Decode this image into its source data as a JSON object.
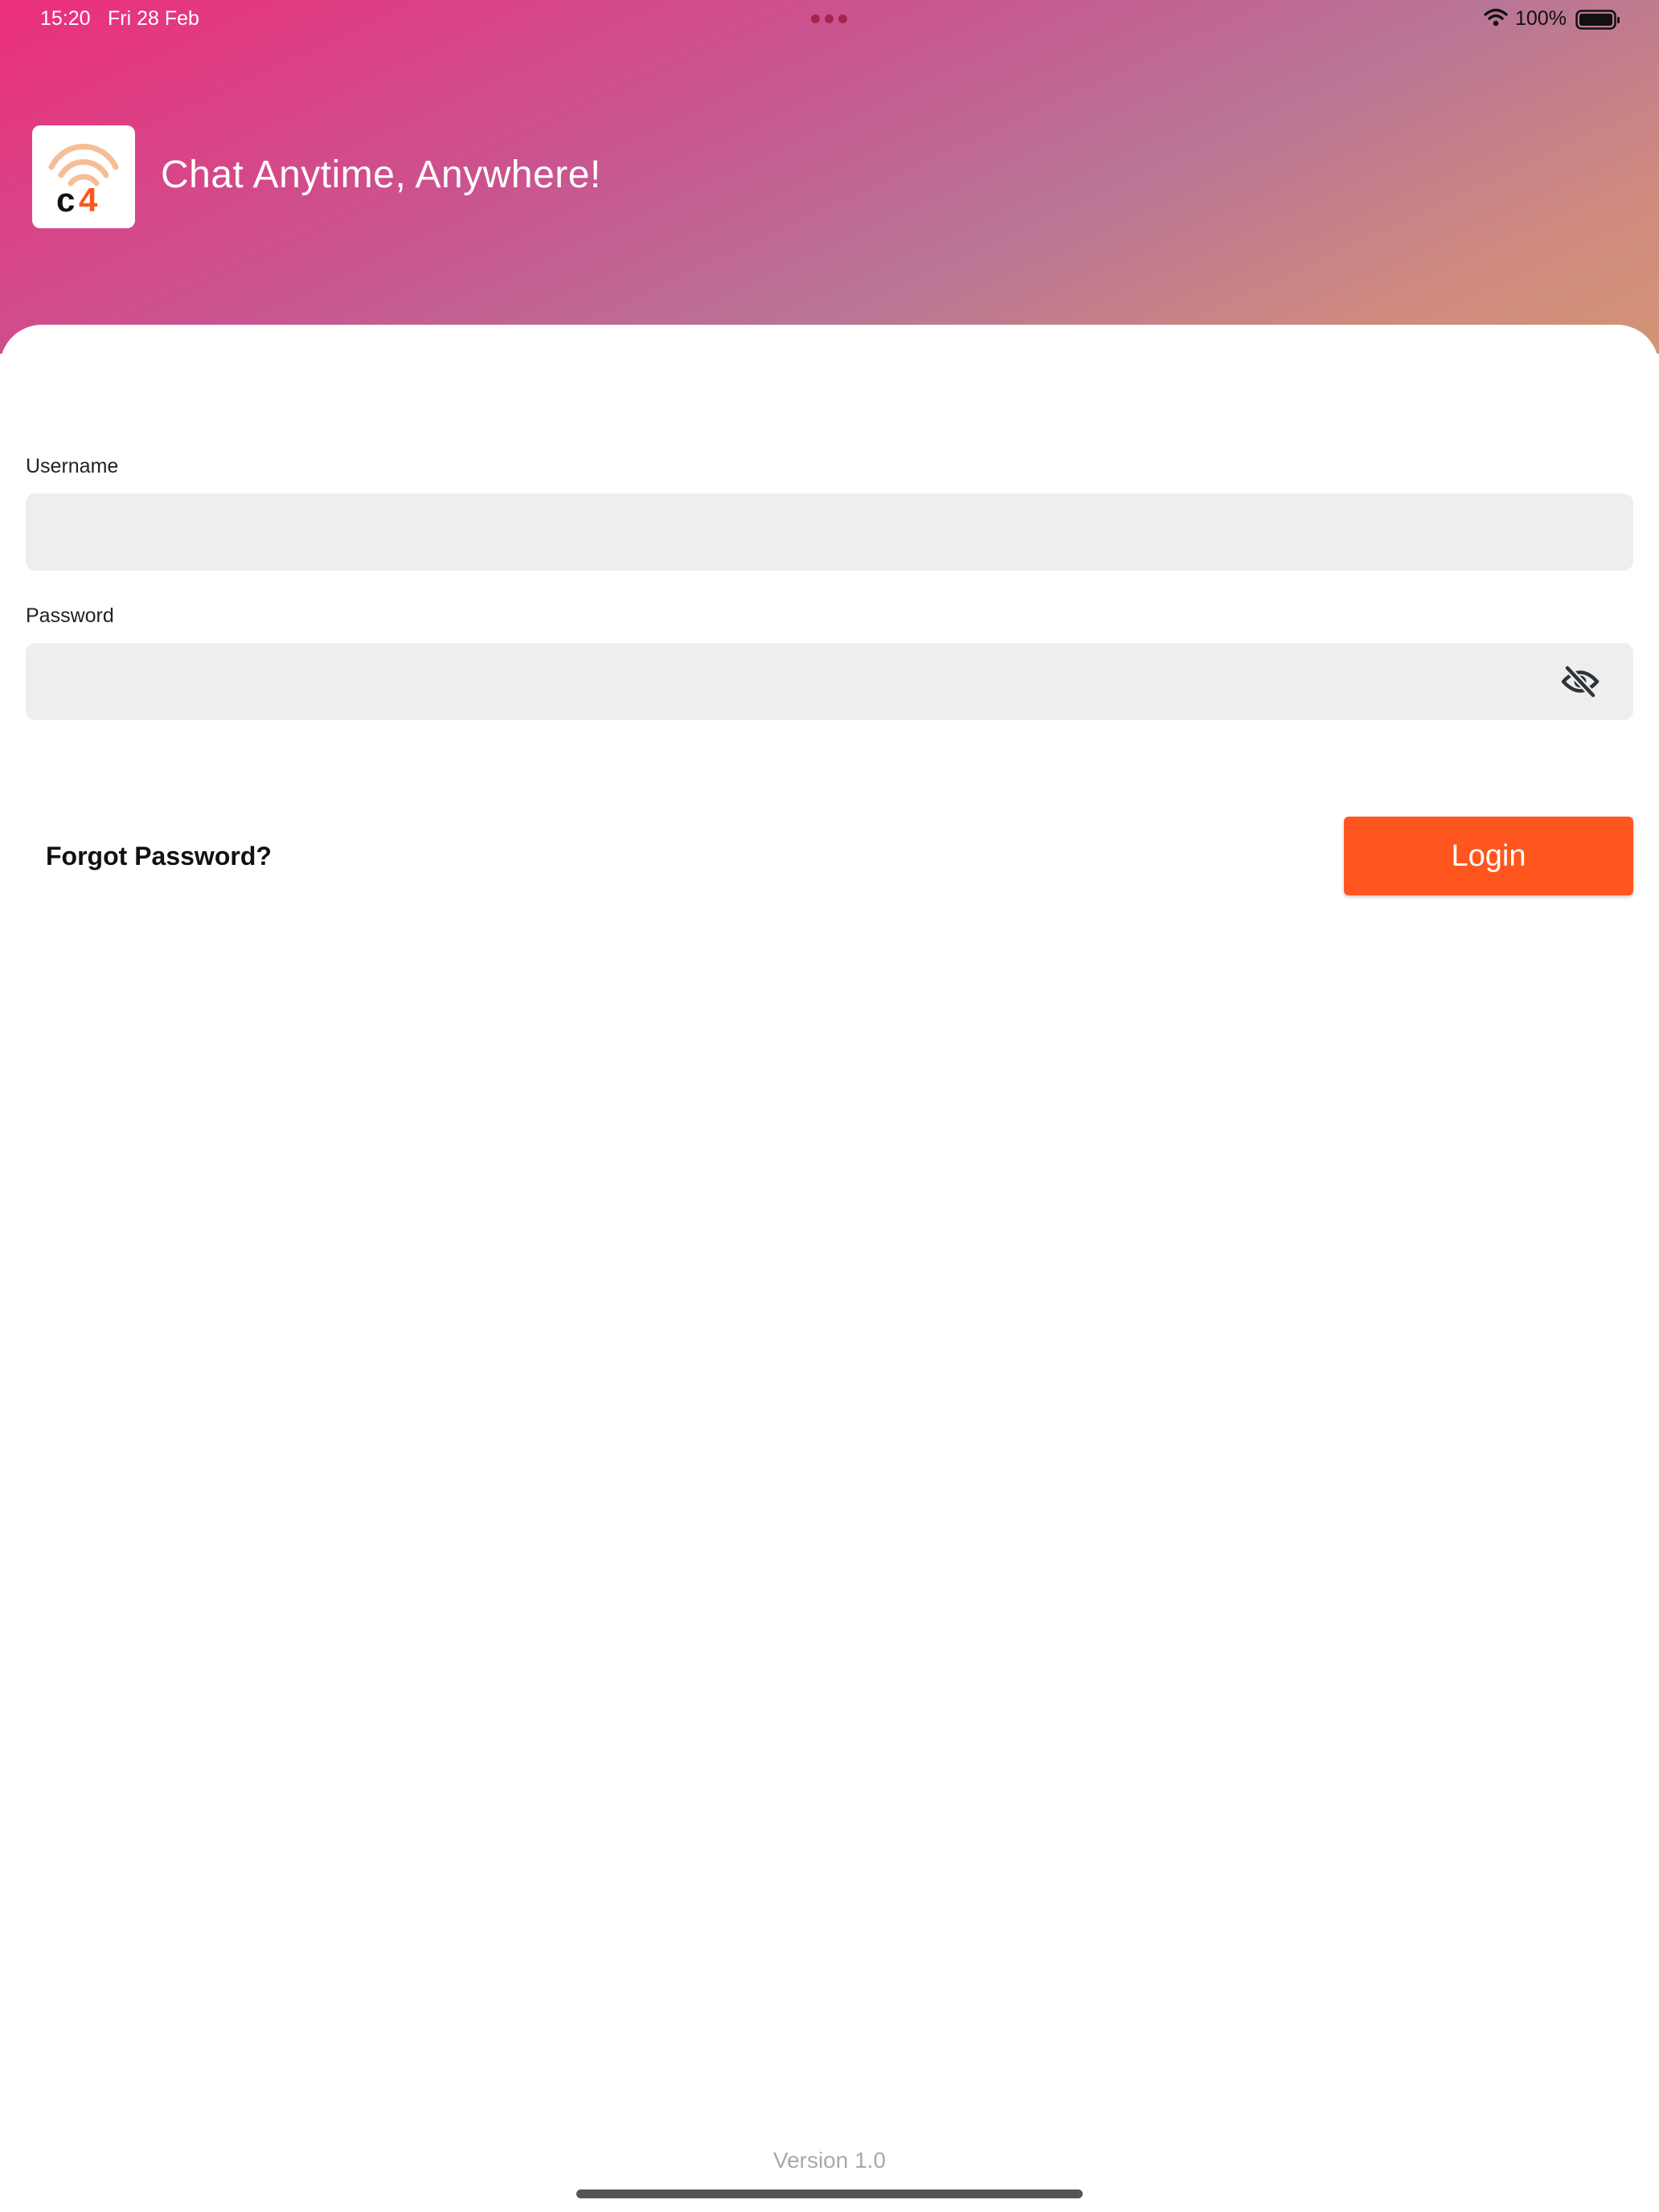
{
  "status_bar": {
    "time": "15:20",
    "date": "Fri 28 Feb",
    "battery": "100%",
    "icons": [
      "wifi-icon",
      "battery-icon",
      "multitasking-dots-icon"
    ]
  },
  "header": {
    "logo_text": "c4",
    "tagline": "Chat Anytime, Anywhere!",
    "gradient_colors": [
      "#ec2f7b",
      "#c95590",
      "#b97595",
      "#d39475"
    ]
  },
  "form": {
    "username": {
      "label": "Username",
      "value": ""
    },
    "password": {
      "label": "Password",
      "value": "",
      "toggle_icon": "eye-off-icon"
    },
    "forgot_password": "Forgot Password?",
    "login_button": "Login"
  },
  "footer": {
    "version": "Version 1.0"
  },
  "colors": {
    "accent": "#ff561f",
    "input_background": "#eeeeee",
    "logo_signal": "#f4bf98"
  }
}
